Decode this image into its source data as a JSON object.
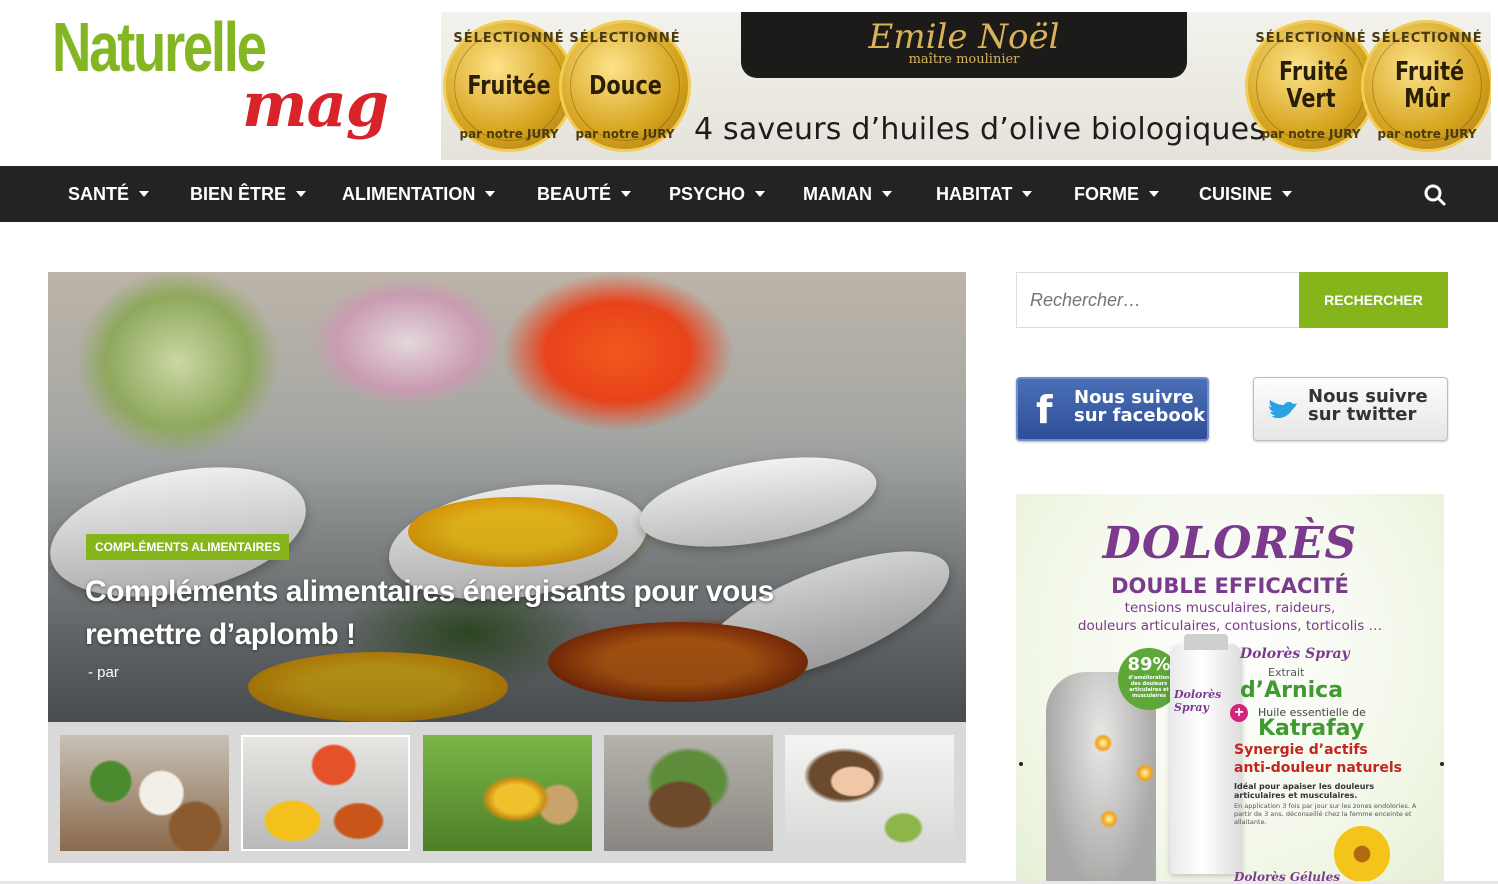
{
  "site": {
    "logo_line1": "Naturelle",
    "logo_line2": "mag"
  },
  "banner": {
    "brand": "Emile Noël",
    "brand_tagline": "maître moulinier",
    "tagline": "4 saveurs d’huiles d’olive biologiques",
    "medal_top": "SÉLECTIONNÉ",
    "medal_bottom": "par notre JURY",
    "medals": [
      "Fruitée",
      "Douce",
      "Fruité Vert",
      "Fruité Mûr"
    ]
  },
  "nav": {
    "items": [
      {
        "label": "SANTÉ"
      },
      {
        "label": "BIEN ÊTRE"
      },
      {
        "label": "ALIMENTATION"
      },
      {
        "label": "BEAUTÉ"
      },
      {
        "label": "PSYCHO"
      },
      {
        "label": "MAMAN"
      },
      {
        "label": "HABITAT"
      },
      {
        "label": "FORME"
      },
      {
        "label": "CUISINE"
      }
    ],
    "search_icon": "search-icon"
  },
  "hero": {
    "category": "COMPLÉMENTS ALIMENTAIRES",
    "title": "Compléments alimentaires énergisants pour vous remettre d’aplomb !",
    "meta": "- par"
  },
  "thumbs": {
    "active_index": 1,
    "items": [
      "thumb-dairy-nuts",
      "thumb-supplements",
      "thumb-oil-bottle",
      "thumb-herbs",
      "thumb-woman-eating"
    ]
  },
  "sidebar": {
    "search_placeholder": "Rechercher…",
    "search_button": "RECHERCHER",
    "facebook_label": "Nous suivre\nsur facebook",
    "twitter_label": "Nous suivre\nsur twitter"
  },
  "ad": {
    "brand": "DOLORÈS",
    "headline": "DOUBLE EFFICACITÉ",
    "sub1": "tensions musculaires, raideurs,",
    "sub2": "douleurs articulaires, contusions, torticolis …",
    "percent": "89%",
    "percent_desc": "d’amélioration des douleurs articulaires et musculaires",
    "spray": "Dolorès Spray",
    "extrait": "Extrait",
    "arnica": "d’Arnica",
    "huile": "Huile essentielle de",
    "katrafay": "Katrafay",
    "synergie1": "Synergie d’actifs",
    "synergie2": "anti-douleur naturels",
    "ideal": "Idéal pour apaiser les douleurs articulaires et musculaires.",
    "small": "En application 3 fois par jour sur les zones endolories. A partir de 3 ans, déconseillé chez la femme enceinte et allaitante.",
    "gelules": "Dolorès Gélules",
    "bottle_label": "Dolorès Spray"
  },
  "colors": {
    "accent_green": "#85b51b",
    "nav_bg": "#232323",
    "logo_red": "#d8232a"
  }
}
